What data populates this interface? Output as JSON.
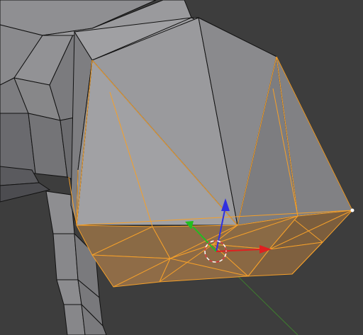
{
  "app": {
    "kind": "3d-viewport-edit-mode",
    "background_color": "#3d3d3d"
  },
  "mesh": {
    "face_color": "#8b8b8e",
    "face_color_dark": "#6f6f73",
    "face_color_light": "#a2a2a6",
    "edge_color": "#111111",
    "selected_face_color": "#8a6a45",
    "selected_edge_color": "#f5a02a",
    "active_vertex_color": "#ffffff"
  },
  "gizmo": {
    "x_axis_color": "#e02020",
    "y_axis_color": "#20c020",
    "z_axis_color": "#3030e0",
    "cursor_ring_color": "#ffffff",
    "cursor_dash_color": "#d03030",
    "grid_axis_color": "#3e7d2e"
  }
}
